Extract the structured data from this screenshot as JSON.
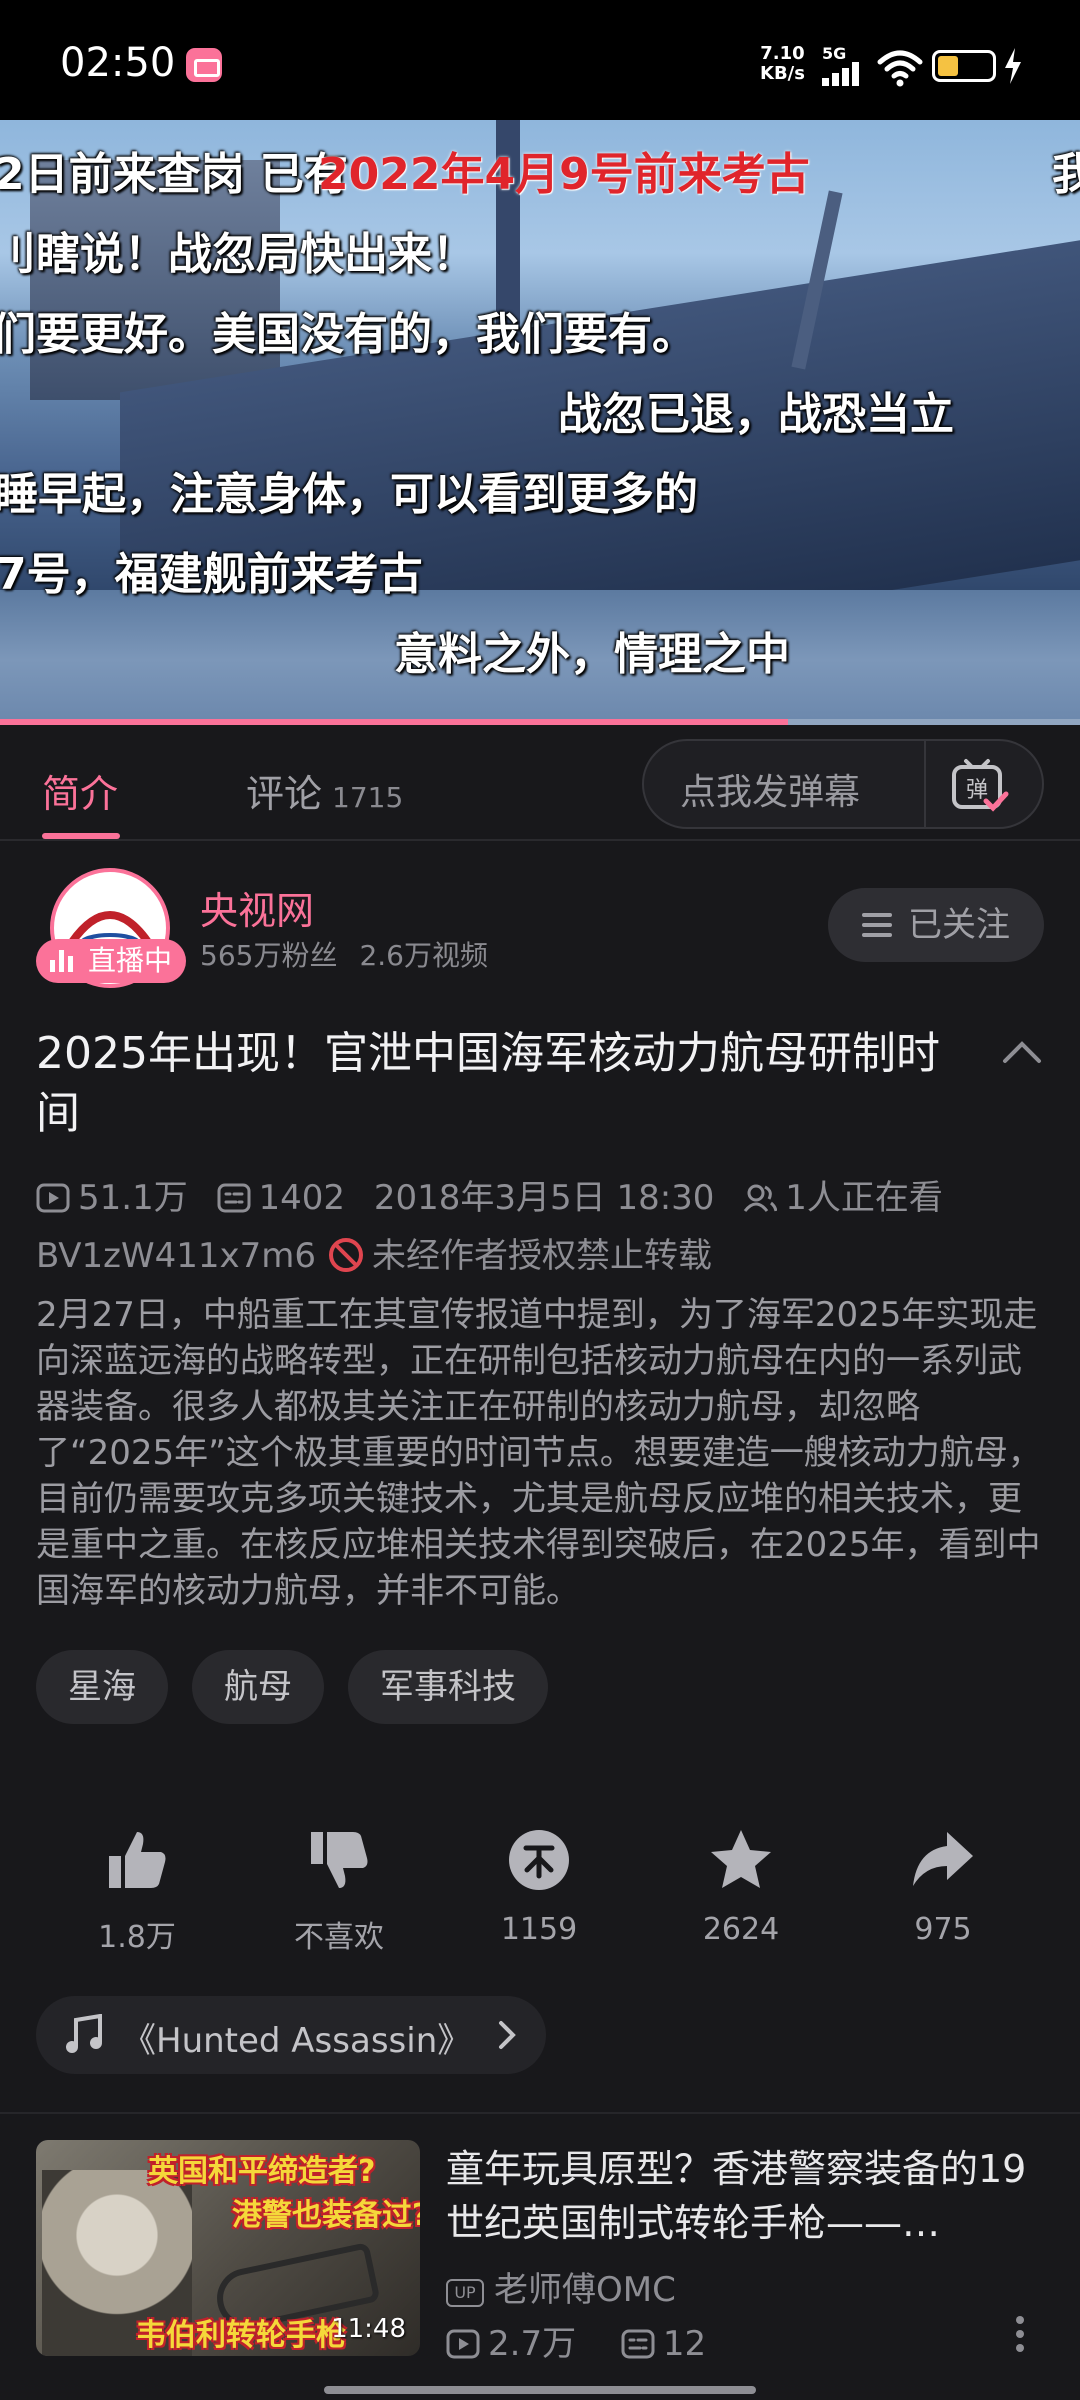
{
  "status_bar": {
    "time": "02:50",
    "net_speed_value": "7.10",
    "net_speed_unit": "KB/s",
    "network": "5G",
    "battery_level": 0.45
  },
  "video": {
    "progress": 0.73,
    "danmaku": [
      "2日前来查岗 已有",
      "2022年4月9号前来考古",
      "我",
      "刂瞎说！战忽局快出来！",
      "们要更好。美国没有的，我们要有。",
      "战忽已退，战恐当立",
      "睡早起，注意身体，可以看到更多的",
      "7号，福建舰前来考古",
      "意料之外，情理之中"
    ]
  },
  "tabs": {
    "intro": "简介",
    "comments": "评论",
    "comments_count": "1715",
    "danmaku_placeholder": "点我发弹幕"
  },
  "uploader": {
    "name": "央视网",
    "live_label": "直播中",
    "fans": "565万粉丝",
    "videos": "2.6万视频",
    "follow_label": "已关注"
  },
  "video_info": {
    "title": "2025年出现！官泄中国海军核动力航母研制时间",
    "views": "51.1万",
    "danmaku_count": "1402",
    "date": "2018年3月5日 18:30",
    "watching": "1人正在看",
    "bvid": "BV1zW411x7m6",
    "copyright": "未经作者授权禁止转载",
    "description": "2月27日，中船重工在其宣传报道中提到，为了海军2025年实现走向深蓝远海的战略转型，正在研制包括核动力航母在内的一系列武器装备。很多人都极其关注正在研制的核动力航母，却忽略了“2025年”这个极其重要的时间节点。想要建造一艘核动力航母，目前仍需要攻克多项关键技术，尤其是航母反应堆的相关技术，更是重中之重。在核反应堆相关技术得到突破后，在2025年，看到中国海军的核动力航母，并非不可能。"
  },
  "tags": [
    "星海",
    "航母",
    "军事科技"
  ],
  "actions": {
    "like": "1.8万",
    "dislike": "不喜欢",
    "coin": "1159",
    "favorite": "2624",
    "share": "975"
  },
  "music": {
    "text": "《Hunted Assassin》"
  },
  "recommendation": {
    "thumb_caption_1": "英国和平缔造者?",
    "thumb_caption_2": "港警也装备过?",
    "thumb_caption_3": "韦伯利转轮手枪",
    "duration": "11:48",
    "title": "童年玩具原型？香港警察装备的19世纪英国制式转轮手枪——…",
    "up_mark": "UP",
    "up_name": "老师傅OMC",
    "views": "2.7万",
    "danmaku": "12"
  },
  "colors": {
    "accent": "#fb7299",
    "background": "#18181b",
    "battery": "#f5c242"
  }
}
